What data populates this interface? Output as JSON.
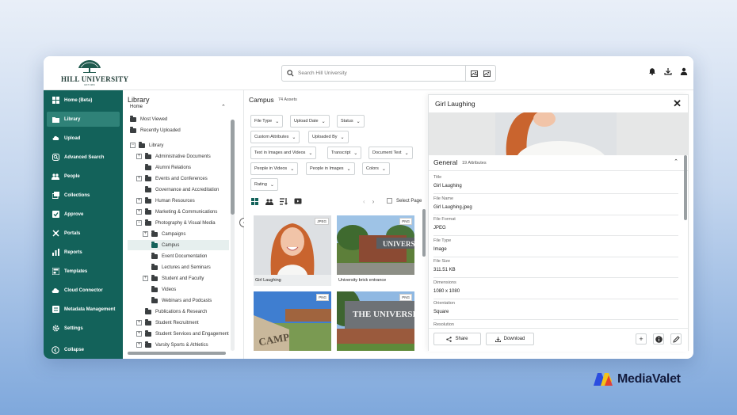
{
  "app": {
    "university_name": "HILL UNIVERSITY",
    "est": "EST 1984"
  },
  "search": {
    "placeholder": "Search Hill University"
  },
  "sidebar": {
    "items": [
      {
        "label": "Home (Beta)",
        "icon": "home-icon"
      },
      {
        "label": "Library",
        "icon": "folder-icon"
      },
      {
        "label": "Upload",
        "icon": "upload-icon"
      },
      {
        "label": "Advanced Search",
        "icon": "advanced-search-icon"
      },
      {
        "label": "People",
        "icon": "people-icon"
      },
      {
        "label": "Collections",
        "icon": "collections-icon"
      },
      {
        "label": "Approve",
        "icon": "approve-icon"
      },
      {
        "label": "Portals",
        "icon": "portals-icon"
      },
      {
        "label": "Reports",
        "icon": "reports-icon"
      },
      {
        "label": "Templates",
        "icon": "templates-icon"
      },
      {
        "label": "Cloud Connector",
        "icon": "cloud-icon"
      },
      {
        "label": "Metadata Management",
        "icon": "metadata-icon"
      },
      {
        "label": "Settings",
        "icon": "gear-icon"
      }
    ],
    "collapse_label": "Collapse",
    "active_index": 1
  },
  "library": {
    "title": "Library",
    "subtitle": "Home",
    "quick": [
      "Most Viewed",
      "Recently Uploaded"
    ],
    "tree": [
      {
        "label": "Library",
        "toggle": "−",
        "depth": 0
      },
      {
        "label": "Administrative Documents",
        "toggle": "+",
        "depth": 1
      },
      {
        "label": "Alumni Relations",
        "toggle": "",
        "depth": 1
      },
      {
        "label": "Events and Conferences",
        "toggle": "+",
        "depth": 1
      },
      {
        "label": "Governance and Accreditation",
        "toggle": "",
        "depth": 1
      },
      {
        "label": "Human Resources",
        "toggle": "+",
        "depth": 1
      },
      {
        "label": "Marketing & Communications",
        "toggle": "+",
        "depth": 1
      },
      {
        "label": "Photography & Visual Media",
        "toggle": "−",
        "depth": 1
      },
      {
        "label": "Campaigns",
        "toggle": "+",
        "depth": 2
      },
      {
        "label": "Campus",
        "toggle": "",
        "depth": 2,
        "selected": true
      },
      {
        "label": "Event Documentation",
        "toggle": "",
        "depth": 2
      },
      {
        "label": "Lectures and Seminars",
        "toggle": "",
        "depth": 2
      },
      {
        "label": "Student and Faculty",
        "toggle": "+",
        "depth": 2
      },
      {
        "label": "Videos",
        "toggle": "",
        "depth": 2
      },
      {
        "label": "Webinars and Podcasts",
        "toggle": "",
        "depth": 2
      },
      {
        "label": "Publications & Research",
        "toggle": "",
        "depth": 1
      },
      {
        "label": "Student Recruitment",
        "toggle": "+",
        "depth": 1
      },
      {
        "label": "Student Services and Engagement",
        "toggle": "+",
        "depth": 1
      },
      {
        "label": "Varsity Sports & Athletics",
        "toggle": "+",
        "depth": 1
      }
    ]
  },
  "main": {
    "title": "Campus",
    "count": "74 Assets",
    "filters": [
      "File Type",
      "Upload Date",
      "Status",
      "Custom Attributes",
      "Uploaded By",
      "Text in Images and Videos",
      "Transcript",
      "Document Text",
      "People in Videos",
      "People in Images",
      "Colors",
      "Rating"
    ],
    "select_page": "Select Page",
    "assets": [
      {
        "name": "Girl Laughing",
        "badge": "JPEG"
      },
      {
        "name": "University brick entrance",
        "badge": "PNG"
      },
      {
        "name": "",
        "badge": "PNG"
      },
      {
        "name": "",
        "badge": "PNG"
      }
    ]
  },
  "detail": {
    "title": "Girl Laughing",
    "section": "General",
    "attr_count": "19 Attributes",
    "attributes": [
      {
        "label": "Title",
        "value": "Girl Laughing"
      },
      {
        "label": "File Name",
        "value": "Girl Laughing.jpeg"
      },
      {
        "label": "File Format",
        "value": "JPEG"
      },
      {
        "label": "File Type",
        "value": "Image"
      },
      {
        "label": "File Size",
        "value": "311.51 KB"
      },
      {
        "label": "Dimensions",
        "value": "1080 x 1080"
      },
      {
        "label": "Orientation",
        "value": "Square"
      },
      {
        "label": "Resolution",
        "value": ""
      }
    ],
    "share_label": "Share",
    "download_label": "Download"
  },
  "brand": {
    "name": "MediaValet"
  }
}
